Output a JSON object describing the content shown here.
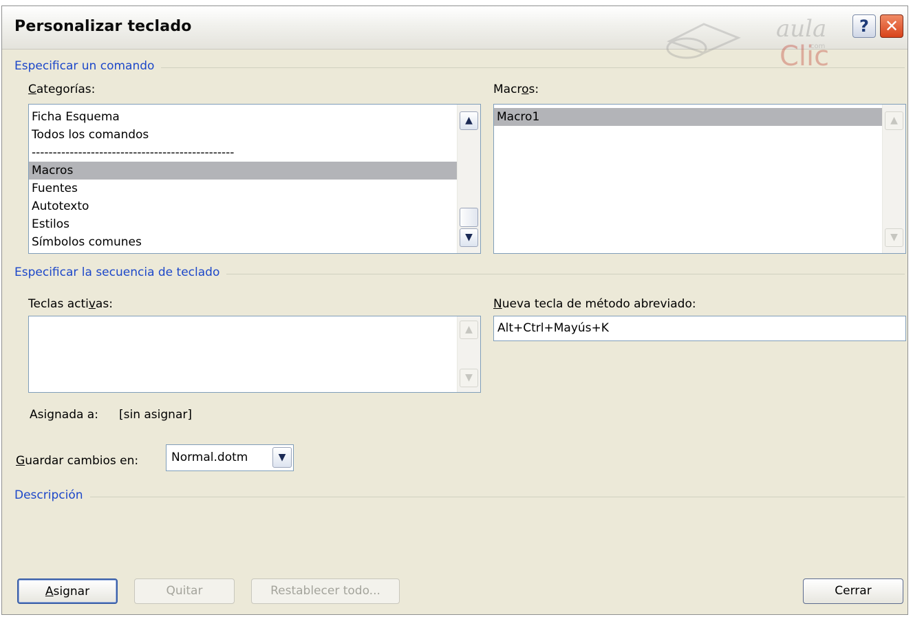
{
  "dialog": {
    "title": "Personalizar teclado",
    "watermark_top": "aula",
    "watermark_bottom": "Clic",
    "watermark_small": "com",
    "help_label": "?",
    "close_label": "✕"
  },
  "command_section": {
    "title": "Especificar un comando",
    "categories_label": "Categorías:",
    "categories": [
      {
        "label": "Ficha Esquema",
        "selected": false
      },
      {
        "label": "Todos los comandos",
        "selected": false
      },
      {
        "label": "------------------------------------------------",
        "selected": false
      },
      {
        "label": "Macros",
        "selected": true
      },
      {
        "label": "Fuentes",
        "selected": false
      },
      {
        "label": "Autotexto",
        "selected": false
      },
      {
        "label": "Estilos",
        "selected": false
      },
      {
        "label": "Símbolos comunes",
        "selected": false
      }
    ],
    "macros_label": "Macros:",
    "macros": [
      {
        "label": "Macro1",
        "selected": true
      }
    ]
  },
  "keys_section": {
    "title": "Especificar la secuencia de teclado",
    "current_keys_label": "Teclas activas:",
    "new_shortcut_label": "Nueva tecla de método abreviado:",
    "new_shortcut_value": "Alt+Ctrl+Mayús+K",
    "assigned_to_label": "Asignada a:",
    "assigned_to_value": "[sin asignar]",
    "save_in_label": "Guardar cambios en:",
    "save_in_value": "Normal.dotm"
  },
  "description_section": {
    "title": "Descripción"
  },
  "buttons": {
    "assign": "Asignar",
    "remove": "Quitar",
    "reset_all": "Restablecer todo...",
    "close": "Cerrar"
  },
  "icons": {
    "help": "question-mark-icon",
    "close": "close-x-icon",
    "scroll_up": "chevron-up-icon",
    "scroll_down": "chevron-down-icon",
    "dropdown": "chevron-down-icon"
  },
  "colors": {
    "dialog_bg": "#ece9d8",
    "group_title": "#1c47c9",
    "selection": "#b3b4b8",
    "close_button": "#d8431b"
  }
}
